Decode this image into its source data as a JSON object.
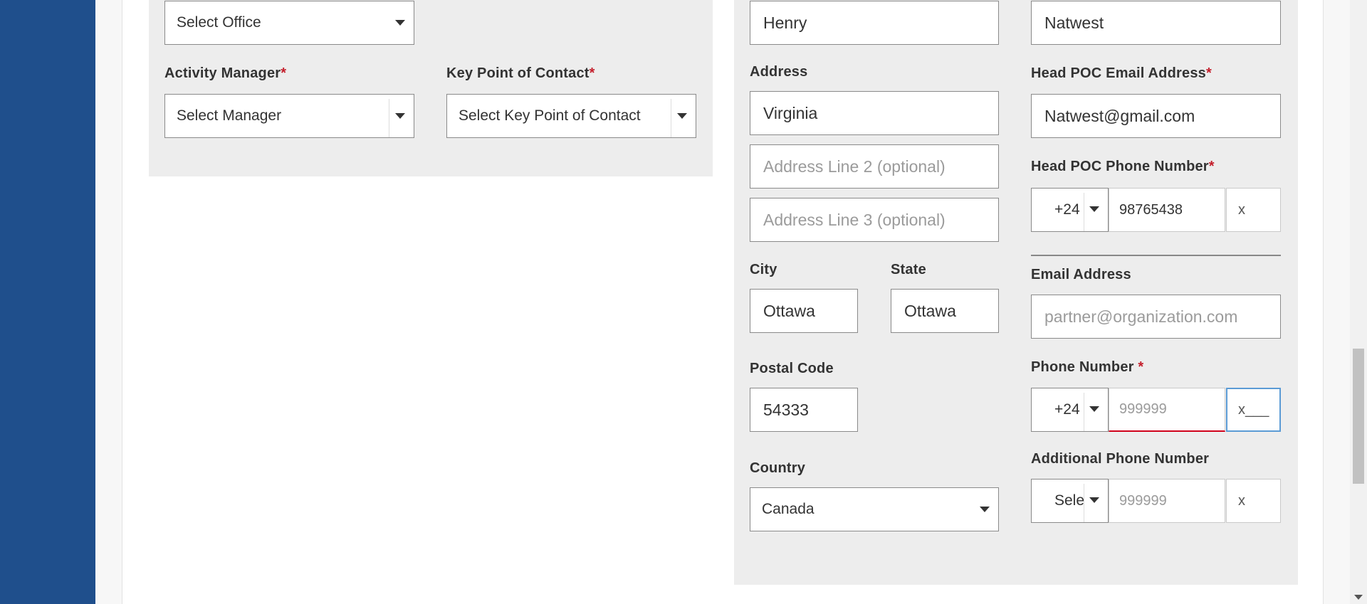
{
  "left_form": {
    "office_select": "Select Office",
    "activity_manager_label": "Activity Manager",
    "activity_manager_select": "Select Manager",
    "key_poc_label": "Key Point of Contact",
    "key_poc_select": "Select Key Point of Contact"
  },
  "address_form": {
    "name_value": "Henry",
    "address_label": "Address",
    "address_line1": "Virginia",
    "address_line2_placeholder": "Address Line 2 (optional)",
    "address_line3_placeholder": "Address Line 3 (optional)",
    "city_label": "City",
    "city_value": "Ottawa",
    "state_label": "State",
    "state_value": "Ottawa",
    "postal_code_label": "Postal Code",
    "postal_code_value": "54333",
    "country_label": "Country",
    "country_value": "Canada"
  },
  "contact_form": {
    "organization_value": "Natwest",
    "head_poc_email_label": "Head POC Email Address",
    "head_poc_email_value": "Natwest@gmail.com",
    "head_poc_phone_label": "Head POC Phone Number",
    "head_poc_phone_code": "+24",
    "head_poc_phone_number": "98765438",
    "head_poc_phone_ext": "x",
    "email_label": "Email Address",
    "email_placeholder": "partner@organization.com",
    "phone_label": "Phone Number",
    "phone_code": "+24",
    "phone_placeholder": "999999",
    "phone_ext": "x___",
    "additional_phone_label": "Additional Phone Number",
    "additional_phone_code": "Sele",
    "additional_phone_placeholder": "999999",
    "additional_phone_ext": "x"
  },
  "required_marker": "*",
  "colors": {
    "sidebar": "#1f4f8c",
    "panel": "#ededed",
    "required": "#c41e2b",
    "error": "#d0021b",
    "focus": "#5b9bd5"
  }
}
